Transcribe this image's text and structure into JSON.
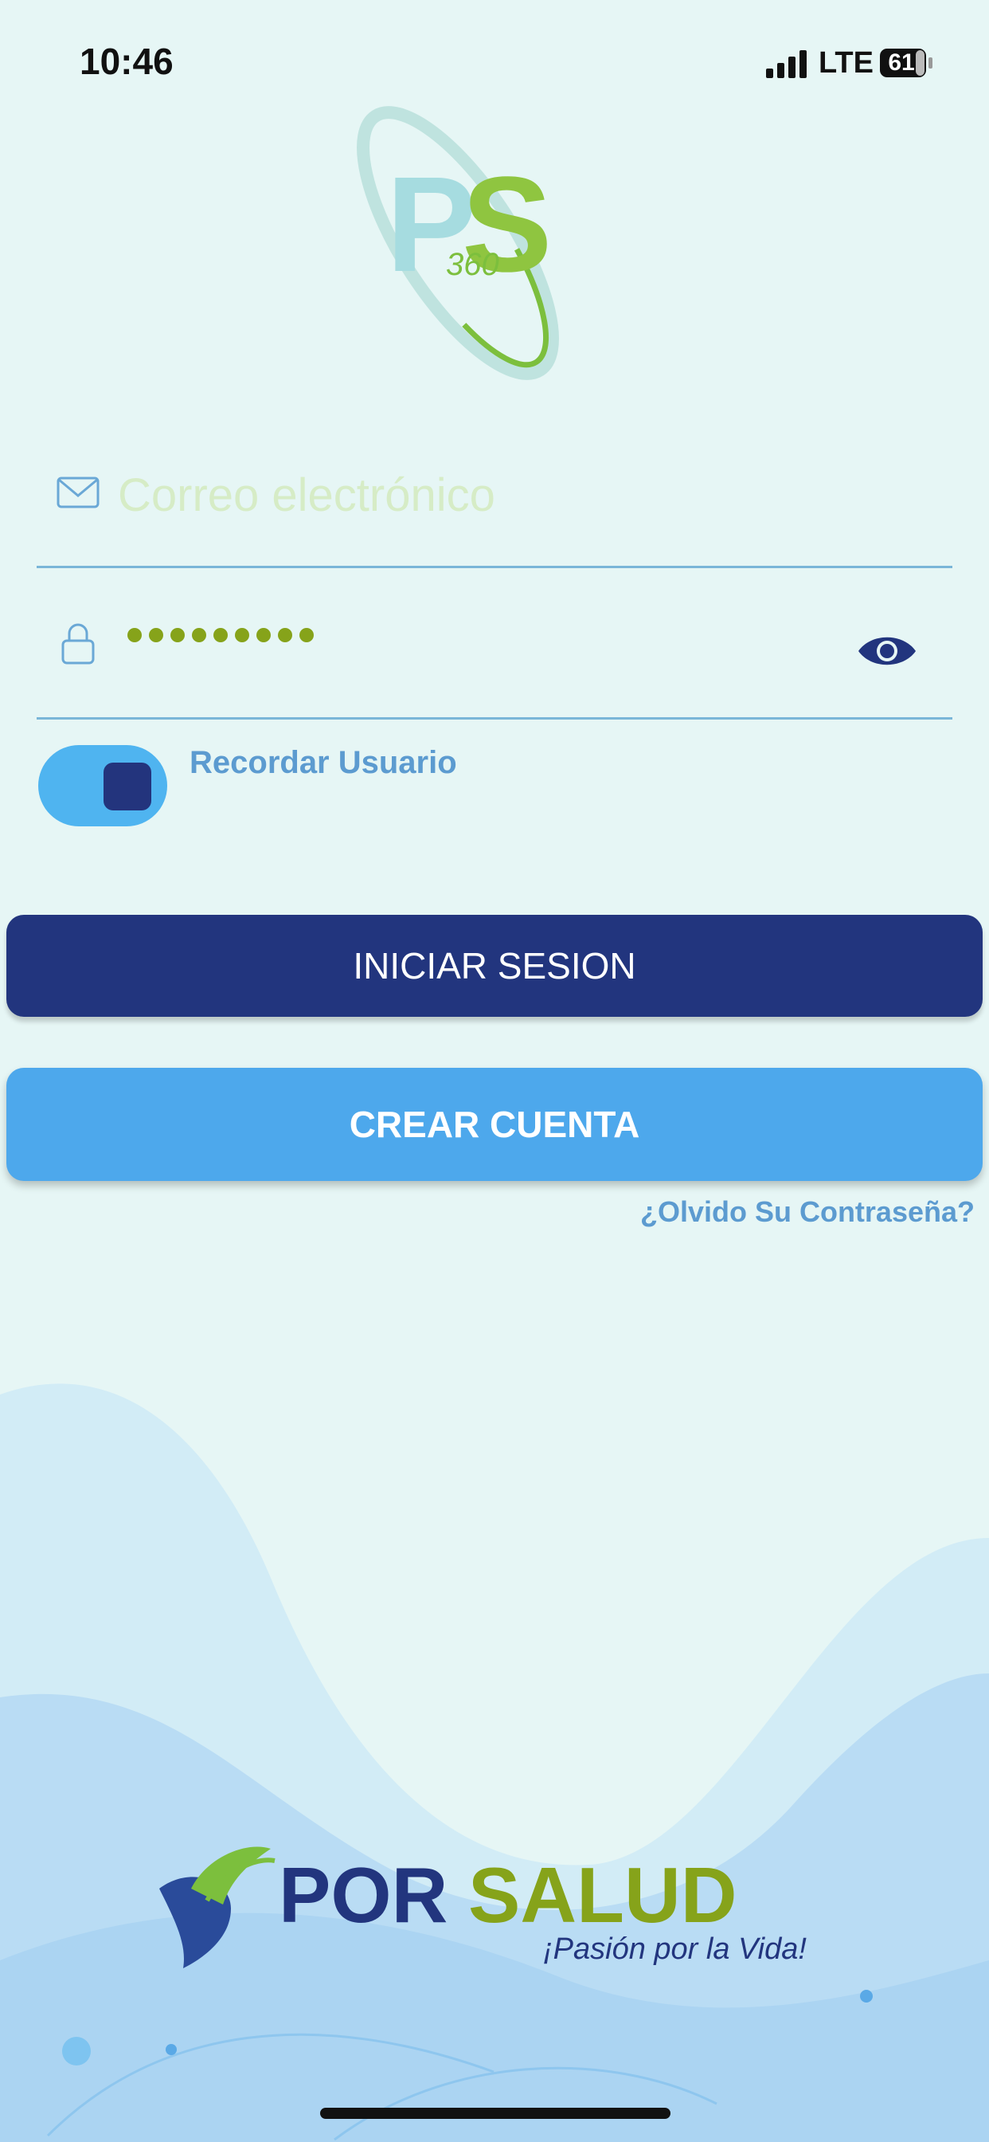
{
  "status_bar": {
    "time": "10:46",
    "network": "LTE",
    "battery": "61",
    "icons": [
      "signal-icon",
      "battery-icon"
    ]
  },
  "app_logo": {
    "mark": "PS",
    "sub": "360",
    "colors": {
      "p": "#a6dce0",
      "s": "#8fc540"
    }
  },
  "login_form": {
    "email": {
      "placeholder": "Correo electrónico",
      "value": "",
      "icon": "mail-icon"
    },
    "password": {
      "masked_length": 9,
      "icon": "lock-icon",
      "toggle_icon": "eye-icon"
    },
    "remember": {
      "label": "Recordar Usuario",
      "checked": true
    },
    "login_button": "INICIAR SESION",
    "signup_button": "CREAR CUENTA",
    "forgot_link": "¿Olvido Su Contraseña?"
  },
  "brand": {
    "name_part1": "POR",
    "name_part2": "SALUD",
    "tagline": "¡Pasión por la Vida!"
  },
  "colors": {
    "background": "#e6f6f5",
    "primary": "#22357e",
    "secondary": "#4da8ec",
    "accent_green": "#86a31a",
    "link": "#5c9bd0"
  }
}
